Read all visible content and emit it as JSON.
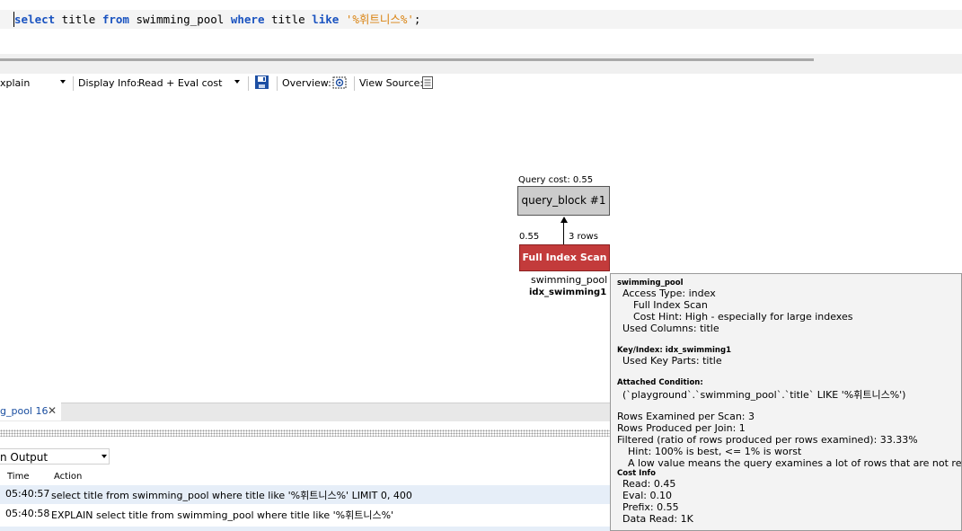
{
  "sql": {
    "tokens": [
      {
        "text": "select",
        "type": "kw"
      },
      {
        "text": " title ",
        "type": "plain"
      },
      {
        "text": "from",
        "type": "kw"
      },
      {
        "text": " swimming_pool ",
        "type": "plain"
      },
      {
        "text": "where",
        "type": "kw"
      },
      {
        "text": " title ",
        "type": "plain"
      },
      {
        "text": "like",
        "type": "kw"
      },
      {
        "text": " ",
        "type": "plain"
      },
      {
        "text": "'%휘트니스%'",
        "type": "str"
      },
      {
        "text": ";",
        "type": "plain"
      }
    ]
  },
  "toolbar": {
    "explain_value": "xplain",
    "display_info_label": "Display Info:",
    "display_info_value": "Read + Eval cost",
    "overview_label": "Overview:",
    "view_source_label": "View Source:",
    "icons": [
      "save-icon",
      "overview-icon",
      "view-source-icon"
    ]
  },
  "diagram": {
    "query_cost": "Query cost: 0.55",
    "query_block": "query_block #1",
    "edge_cost": "0.55",
    "edge_rows": "3 rows",
    "scan_label": "Full Index Scan",
    "table_name": "swimming_pool",
    "index_name": "idx_swimming1",
    "colors": {
      "query_block": "#cccccc",
      "scan": "#c33b3b"
    }
  },
  "tooltip": {
    "title": "swimming_pool",
    "access_type": "Access Type: index",
    "access_detail": "Full Index Scan",
    "cost_hint": "Cost Hint: High - especially for large indexes",
    "used_columns": "Used Columns:  title",
    "key_index": "Key/Index:  idx_swimming1",
    "used_key_parts": "Used Key Parts:  title",
    "attached_condition_header": "Attached Condition:",
    "attached_condition": "(`playground`.`swimming_pool`.`title` LIKE '%휘트니스%')",
    "rows_examined": "Rows Examined per Scan:  3",
    "rows_produced": "Rows Produced per Join:  1",
    "filtered": "Filtered (ratio of rows produced per rows examined):  33.33%",
    "hint": "Hint: 100% is best, <= 1% is worst",
    "low_value": "A low value means the query examines a lot of rows that are not returned.",
    "cost_info_header": "Cost Info",
    "read": "Read: 0.45",
    "eval": "Eval: 0.10",
    "prefix": "Prefix: 0.55",
    "data_read": "Data Read: 1K"
  },
  "bottom": {
    "tab_label": "g_pool 16",
    "output_select": "n Output",
    "columns": {
      "time": "Time",
      "action": "Action"
    },
    "rows": [
      {
        "time": "05:40:57",
        "action": "select title from swimming_pool where title like '%휘트니스%' LIMIT 0, 400"
      },
      {
        "time": "05:40:58",
        "action": "EXPLAIN select title from swimming_pool where title like '%휘트니스%'"
      }
    ]
  }
}
